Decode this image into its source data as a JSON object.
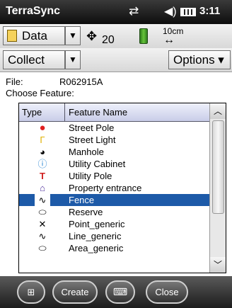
{
  "titlebar": {
    "app_title": "TerraSync",
    "clock": "3:11",
    "icons": [
      "sync-arrows-icon",
      "speaker-icon",
      "battery-icon"
    ]
  },
  "toolbar1": {
    "data_label": "Data",
    "satellite_count": "20",
    "accuracy_label": "10cm",
    "accuracy_arrow": "↔"
  },
  "toolbar2": {
    "collect_label": "Collect",
    "options_label": "Options ▾"
  },
  "file": {
    "label": "File:",
    "value": "R062915A"
  },
  "choose_label": "Choose Feature:",
  "list": {
    "headers": {
      "type": "Type",
      "name": "Feature Name"
    },
    "selected": "Fence",
    "items": [
      {
        "name": "Street Pole",
        "icon": "street-pole-icon"
      },
      {
        "name": "Street Light",
        "icon": "street-light-icon"
      },
      {
        "name": "Manhole",
        "icon": "manhole-icon"
      },
      {
        "name": "Utility Cabinet",
        "icon": "utility-cabinet-icon"
      },
      {
        "name": "Utility Pole",
        "icon": "utility-pole-icon"
      },
      {
        "name": "Property entrance",
        "icon": "property-entrance-icon"
      },
      {
        "name": "Fence",
        "icon": "line-feature-icon"
      },
      {
        "name": "Reserve",
        "icon": "area-feature-icon"
      },
      {
        "name": "Point_generic",
        "icon": "point-feature-icon"
      },
      {
        "name": "Line_generic",
        "icon": "line-feature-icon"
      },
      {
        "name": "Area_generic",
        "icon": "area-feature-icon"
      }
    ]
  },
  "bottombar": {
    "create_label": "Create",
    "close_label": "Close"
  }
}
